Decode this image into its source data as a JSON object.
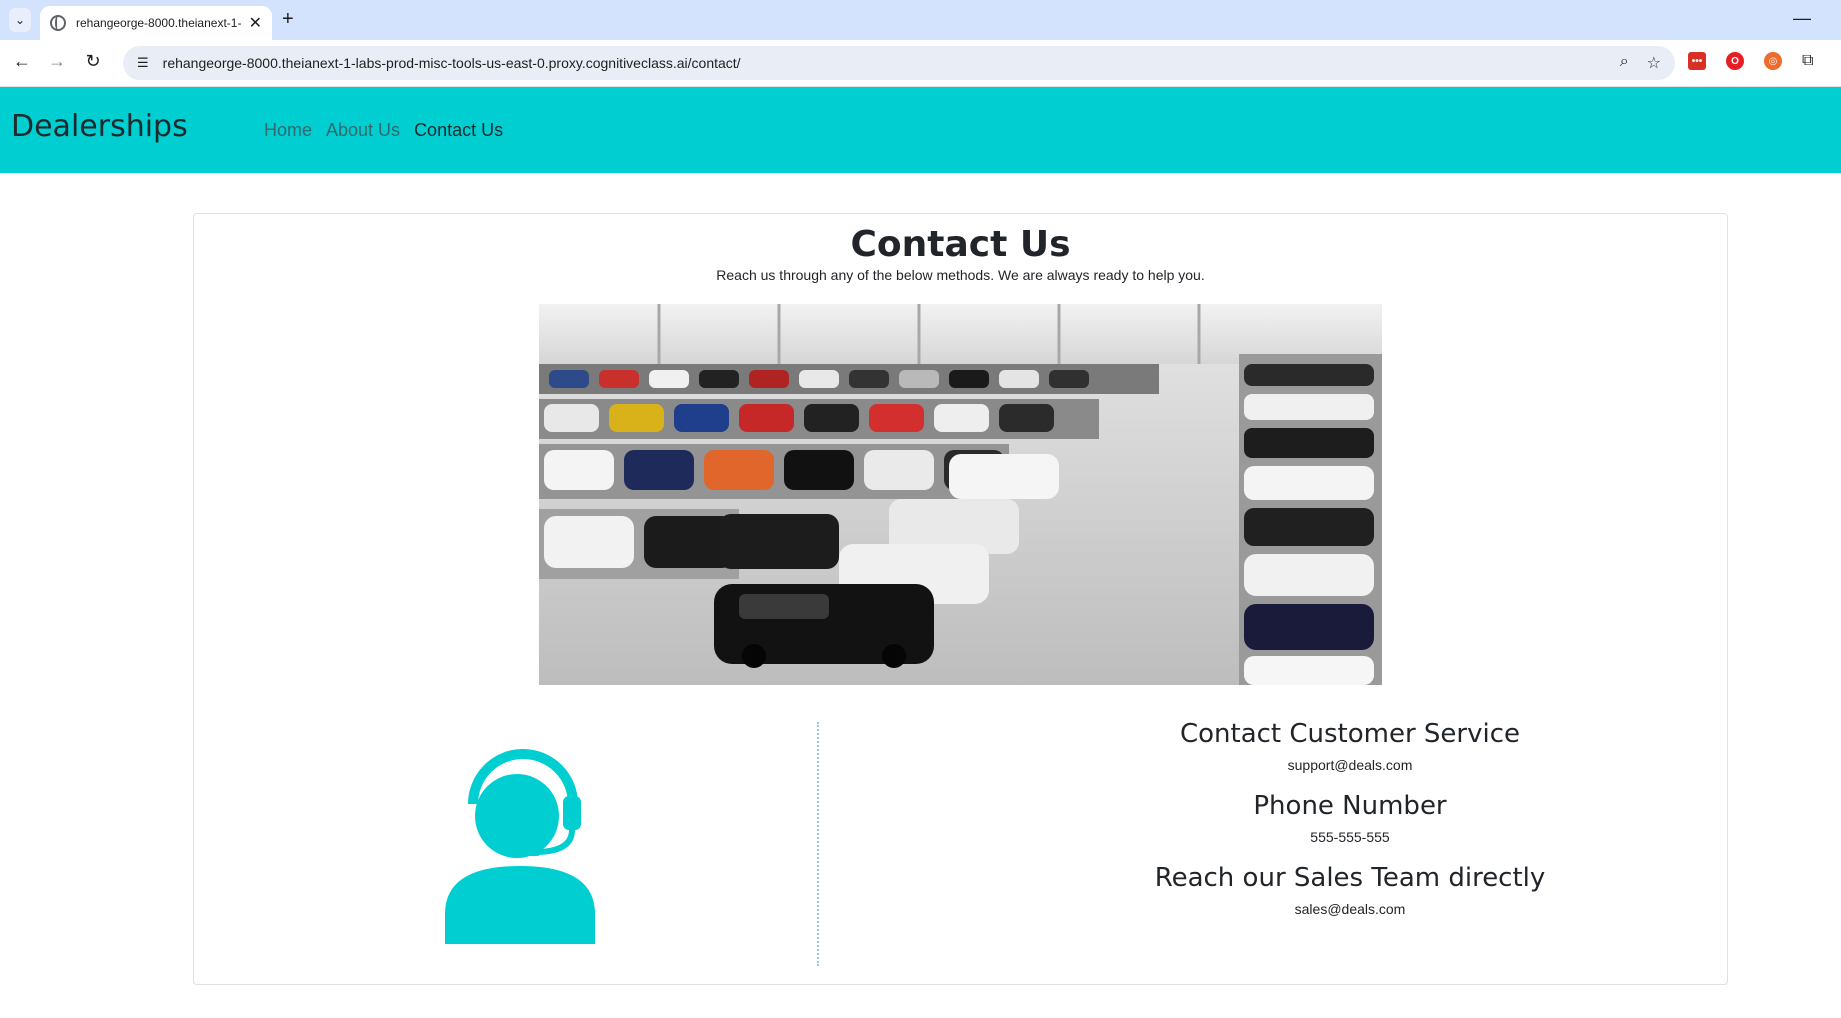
{
  "browser": {
    "tab_title": "rehangeorge-8000.theianext-1-",
    "url": "rehangeorge-8000.theianext-1-labs-prod-misc-tools-us-east-0.proxy.cognitiveclass.ai/contact/"
  },
  "navbar": {
    "brand": "Dealerships",
    "links": [
      {
        "label": "Home"
      },
      {
        "label": "About Us"
      },
      {
        "label": "Contact Us"
      }
    ],
    "background": "#00ced1"
  },
  "card": {
    "title": "Contact Us",
    "subtitle": "Reach us through any of the below methods. We are always ready to help you."
  },
  "contact": {
    "customer_service_heading": "Contact Customer Service",
    "customer_service_email": "support@deals.com",
    "phone_heading": "Phone Number",
    "phone_value": "555-555-555",
    "sales_heading": "Reach our Sales Team directly",
    "sales_email": "sales@deals.com"
  },
  "icons": {
    "agent": "customer-support-agent-icon",
    "accent": "#00ced1"
  }
}
